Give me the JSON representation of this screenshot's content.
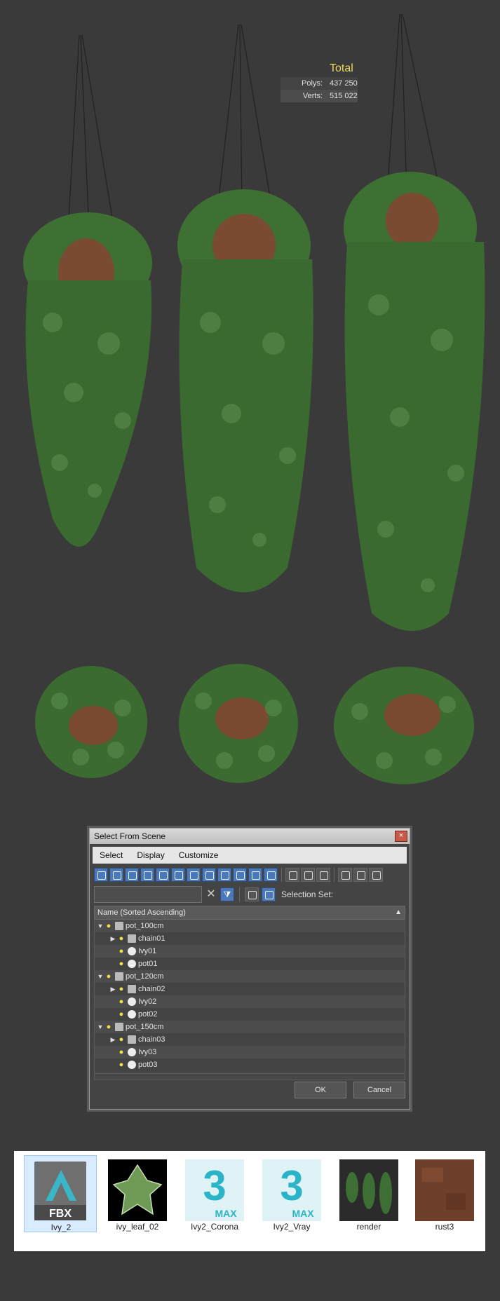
{
  "stats": {
    "total_label": "Total",
    "polys_label": "Polys:",
    "polys_value": "437 250",
    "verts_label": "Verts:",
    "verts_value": "515 022"
  },
  "dialog": {
    "title": "Select From Scene",
    "close_glyph": "×",
    "menu": [
      "Select",
      "Display",
      "Customize"
    ],
    "search_placeholder": "",
    "clear_glyph": "✕",
    "selection_set_label": "Selection Set:",
    "list_header": "Name (Sorted Ascending)",
    "rows": [
      {
        "name": "pot_100cm",
        "level": 0,
        "expander": "▼"
      },
      {
        "name": "chain01",
        "level": 1,
        "expander": "▶"
      },
      {
        "name": "Ivy01",
        "level": 1,
        "expander": ""
      },
      {
        "name": "pot01",
        "level": 1,
        "expander": ""
      },
      {
        "name": "pot_120cm",
        "level": 0,
        "expander": "▼"
      },
      {
        "name": "chain02",
        "level": 1,
        "expander": "▶"
      },
      {
        "name": "Ivy02",
        "level": 1,
        "expander": ""
      },
      {
        "name": "pot02",
        "level": 1,
        "expander": ""
      },
      {
        "name": "pot_150cm",
        "level": 0,
        "expander": "▼"
      },
      {
        "name": "chain03",
        "level": 1,
        "expander": "▶"
      },
      {
        "name": "Ivy03",
        "level": 1,
        "expander": ""
      },
      {
        "name": "pot03",
        "level": 1,
        "expander": ""
      }
    ],
    "ok_label": "OK",
    "cancel_label": "Cancel"
  },
  "files": [
    {
      "name": "Ivy_2",
      "icon": "fbx-icon",
      "badge": "FBX",
      "selected": true
    },
    {
      "name": "ivy_leaf_02",
      "icon": "leaf-icon",
      "selected": false
    },
    {
      "name": "Ivy2_Corona",
      "icon": "max-icon",
      "badge_num": "3",
      "badge": "MAX",
      "selected": false
    },
    {
      "name": "Ivy2_Vray",
      "icon": "max-icon",
      "badge_num": "3",
      "badge": "MAX",
      "selected": false
    },
    {
      "name": "render",
      "icon": "render-thumb-icon",
      "selected": false
    },
    {
      "name": "rust3",
      "icon": "rust-texture-icon",
      "selected": false
    }
  ],
  "colors": {
    "viewport_bg": "#3a3a3a",
    "stats_text": "#e9d95a",
    "foliage": "#3d6e34",
    "pot": "#7a4a32",
    "max_teal": "#2bb3c7"
  }
}
